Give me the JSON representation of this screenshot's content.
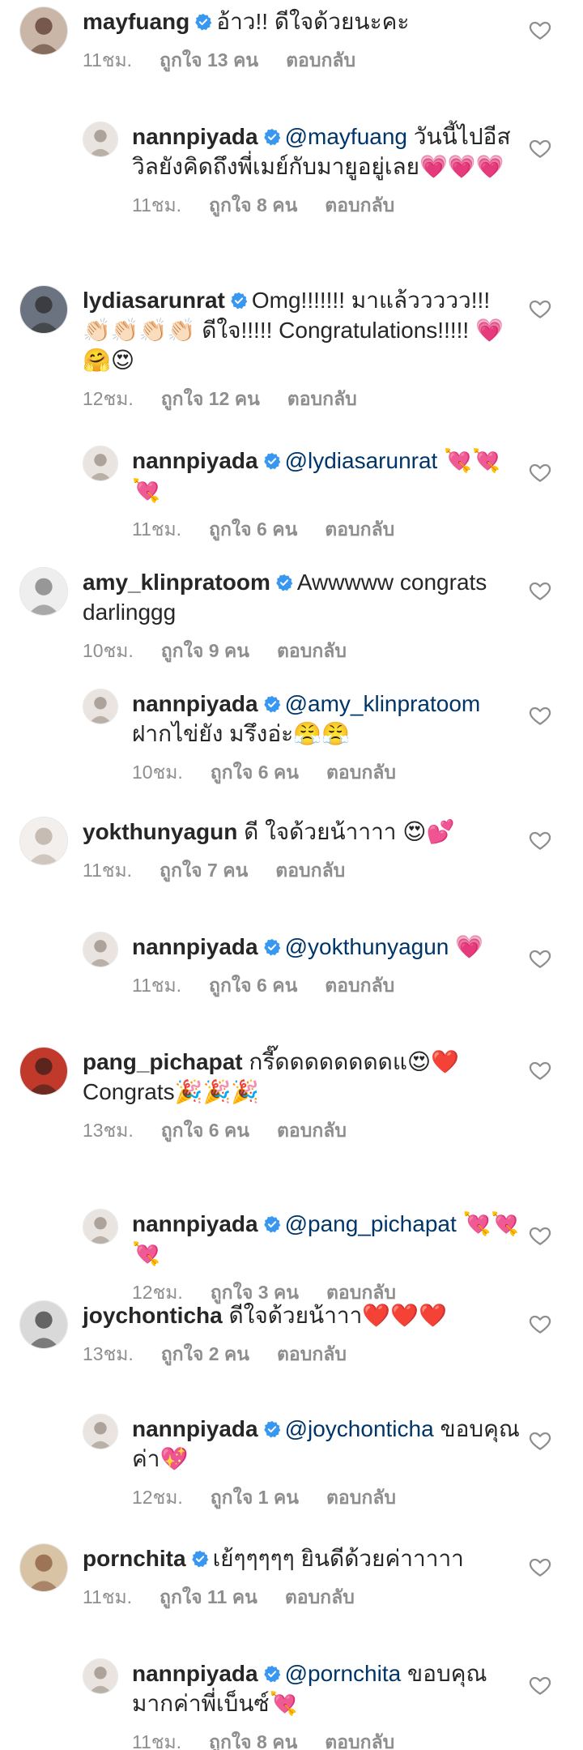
{
  "labels": {
    "likes_prefix": "ถูกใจ",
    "likes_suffix": "คน",
    "reply": "ตอบกลับ"
  },
  "comments": [
    {
      "user": "mayfuang",
      "verified": true,
      "mention": "",
      "text": "อ้าว!! ดีใจด้วยนะคะ",
      "time": "11ชม.",
      "likes": "13",
      "avatar": "woman-portrait"
    },
    {
      "user": "nannpiyada",
      "verified": true,
      "mention": "@mayfuang",
      "text": "วันนี้ไปอีสวิลยังคิดถึงพี่เมย์กับมายูอยู่เลย💗💗💗",
      "time": "11ชม.",
      "likes": "8",
      "avatar": "nannpiyada-portrait"
    },
    {
      "user": "lydiasarunrat",
      "verified": true,
      "mention": "",
      "text": "Omg!!!!!!! มาแล้ววววว!!! 👏🏻👏🏻👏🏻👏🏻 ดีใจ!!!!! Congratulations!!!!! 💗🤗😍",
      "time": "12ชม.",
      "likes": "12",
      "avatar": "couple-portrait"
    },
    {
      "user": "nannpiyada",
      "verified": true,
      "mention": "@lydiasarunrat",
      "text": "💘💘💘",
      "time": "11ชม.",
      "likes": "6",
      "avatar": "nannpiyada-portrait"
    },
    {
      "user": "amy_klinpratoom",
      "verified": true,
      "mention": "",
      "text": "Awwwww congrats darlinggg",
      "time": "10ชม.",
      "likes": "9",
      "avatar": "sketch-portrait"
    },
    {
      "user": "nannpiyada",
      "verified": true,
      "mention": "@amy_klinpratoom",
      "text": "ฝากไข่ยัง มรึงอ่ะ😤😤",
      "time": "10ชม.",
      "likes": "6",
      "avatar": "nannpiyada-portrait"
    },
    {
      "user": "yokthunyagun",
      "verified": false,
      "mention": "",
      "text": "ดี ใจด้วยน้าาาา 😍💕",
      "time": "11ชม.",
      "likes": "7",
      "avatar": "woman-back-portrait"
    },
    {
      "user": "nannpiyada",
      "verified": true,
      "mention": "@yokthunyagun",
      "text": "💗",
      "time": "11ชม.",
      "likes": "6",
      "avatar": "nannpiyada-portrait"
    },
    {
      "user": "pang_pichapat",
      "verified": false,
      "mention": "",
      "text": "กรี๊ดดดดดดดดแ😍❤️ Congrats🎉🎉🎉",
      "time": "13ชม.",
      "likes": "6",
      "avatar": "woman-red-portrait"
    },
    {
      "user": "nannpiyada",
      "verified": true,
      "mention": "@pang_pichapat",
      "text": "💘💘💘",
      "time": "12ชม.",
      "likes": "3",
      "avatar": "nannpiyada-portrait"
    },
    {
      "user": "joychonticha",
      "verified": false,
      "mention": "",
      "text": "ดีใจด้วยน้าาา❤️❤️❤️",
      "time": "13ชม.",
      "likes": "2",
      "avatar": "bw-portrait"
    },
    {
      "user": "nannpiyada",
      "verified": true,
      "mention": "@joychonticha",
      "text": "ขอบคุณค่า💖",
      "time": "12ชม.",
      "likes": "1",
      "avatar": "nannpiyada-portrait"
    },
    {
      "user": "pornchita",
      "verified": true,
      "mention": "",
      "text": "เย้ๆๆๆๆๆ ยินดีด้วยค่าาาาา",
      "time": "11ชม.",
      "likes": "11",
      "avatar": "group-portrait"
    },
    {
      "user": "nannpiyada",
      "verified": true,
      "mention": "@pornchita",
      "text": "ขอบคุณมากค่าพี่เบ็นซ์💘",
      "time": "11ชม.",
      "likes": "8",
      "avatar": "nannpiyada-portrait"
    }
  ],
  "colors": {
    "text": "#262626",
    "meta": "#8e8e8e",
    "mention": "#003569",
    "verified": "#3897f0"
  }
}
